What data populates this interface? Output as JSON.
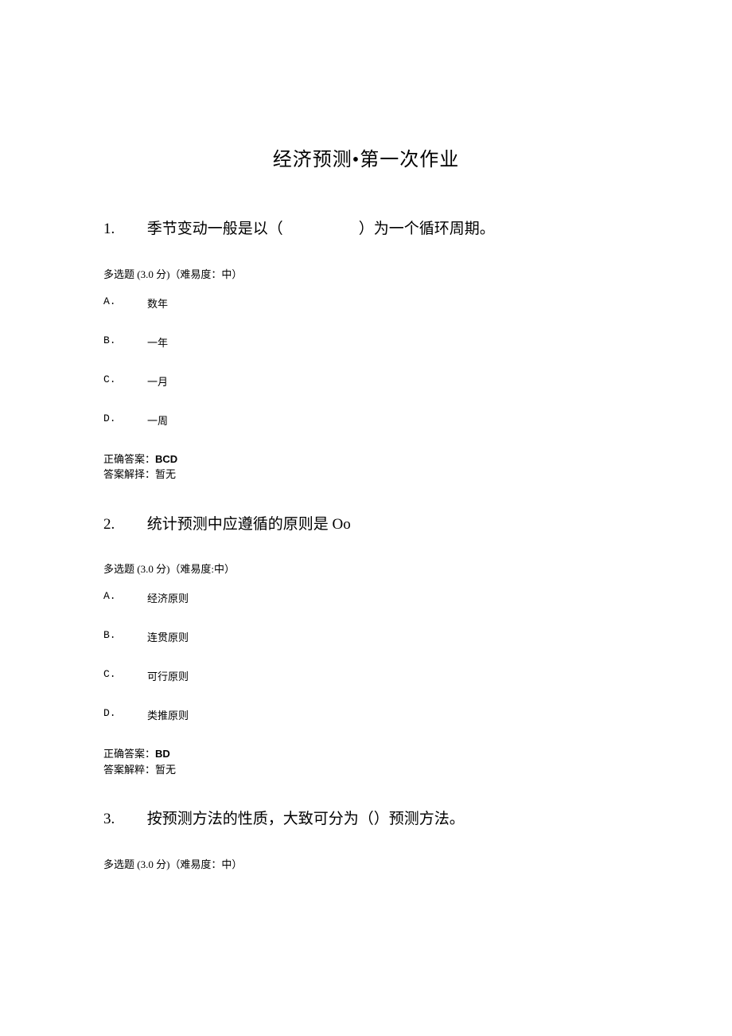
{
  "title": "经济预测•第一次作业",
  "questions": [
    {
      "number": "1.",
      "text": "季节变动一般是以（　　　　　）为一个循环周期。",
      "meta": "多选题 (3.0 分)（难易度：中）",
      "options": [
        {
          "letter": "A.",
          "text": "数年"
        },
        {
          "letter": "B.",
          "text": "一年"
        },
        {
          "letter": "C.",
          "text": "一月"
        },
        {
          "letter": "D.",
          "text": "一周"
        }
      ],
      "answer_label": "正确答案：",
      "answer_value": "BCD",
      "explain": "答案解择：暂无"
    },
    {
      "number": "2.",
      "text": "统计预测中应遵循的原则是 Oo",
      "meta": "多选题 (3.0 分)（难易度:中）",
      "options": [
        {
          "letter": "A.",
          "text": "经济原则"
        },
        {
          "letter": "B.",
          "text": "连贯原则"
        },
        {
          "letter": "C.",
          "text": "可行原则"
        },
        {
          "letter": "D.",
          "text": "类推原则"
        }
      ],
      "answer_label": "正确答案：",
      "answer_value": "BD",
      "explain": "答案解粹：暂无"
    },
    {
      "number": "3.",
      "text": "按预测方法的性质，大致可分为（）预测方法。",
      "meta": "多选题 (3.0 分)（难易度：中）",
      "options": [],
      "answer_label": "",
      "answer_value": "",
      "explain": ""
    }
  ]
}
